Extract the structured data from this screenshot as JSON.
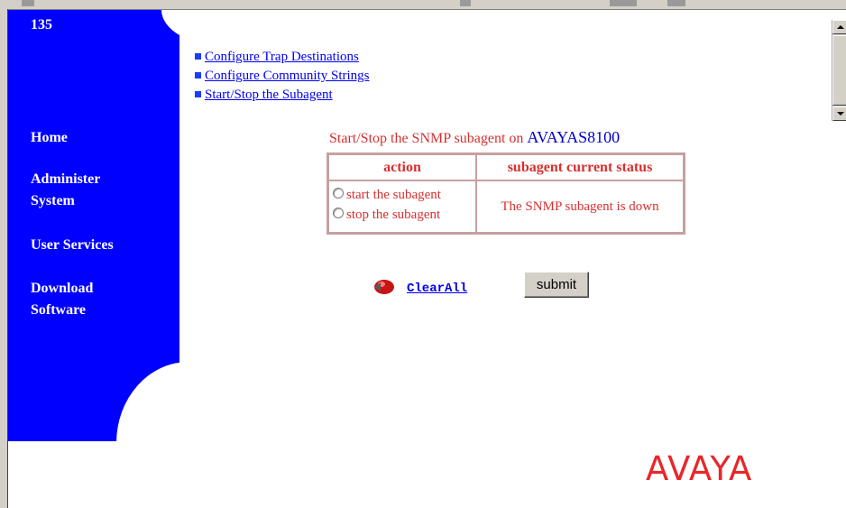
{
  "page": {
    "id_number": "135"
  },
  "sidebar": {
    "items": [
      {
        "label": "Home"
      },
      {
        "label": "Administer System",
        "line1": "Administer",
        "line2": "System"
      },
      {
        "label": "User Services"
      },
      {
        "label": "Download Software",
        "line1": "Download",
        "line2": "Software"
      }
    ]
  },
  "links": [
    {
      "label": "Configure Trap Destinations"
    },
    {
      "label": "Configure Community Strings"
    },
    {
      "label": "Start/Stop the Subagent"
    }
  ],
  "heading": {
    "text": "Start/Stop the SNMP subagent on ",
    "host": "AVAYAS8100"
  },
  "table": {
    "headers": [
      "action",
      "subagent current status"
    ],
    "options": [
      "start the subagent",
      "stop the subagent"
    ],
    "status": "The SNMP subagent is down"
  },
  "actions": {
    "clear_all": "ClearAll",
    "submit": "submit"
  },
  "logo": {
    "text": "AVAYA"
  },
  "colors": {
    "sidebar": "#0000ff",
    "table_text": "#d63030",
    "link": "#0000ee",
    "logo": "#e8262b"
  }
}
